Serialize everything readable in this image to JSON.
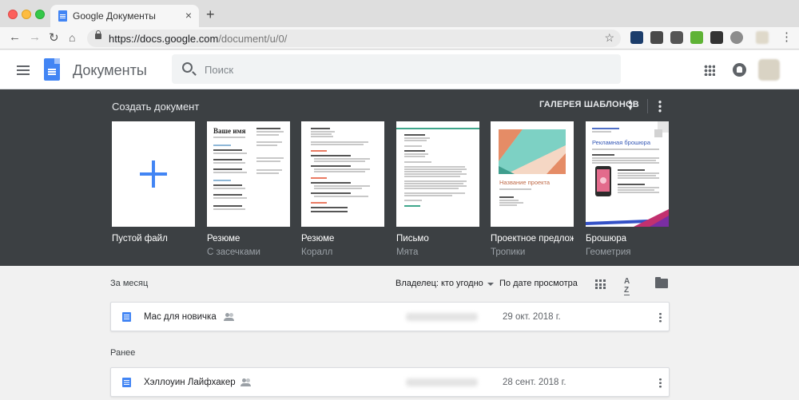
{
  "browser": {
    "tab_title": "Google Документы",
    "tab_close": "×",
    "new_tab": "+",
    "url_host": "https://docs.google.com",
    "url_path": "/document/u/0/"
  },
  "app": {
    "title": "Документы",
    "search_placeholder": "Поиск"
  },
  "templates": {
    "heading": "Создать документ",
    "gallery_label": "ГАЛЕРЕЯ ШАБЛОНОВ",
    "items": [
      {
        "name": "Пустой файл",
        "subtitle": ""
      },
      {
        "name": "Резюме",
        "subtitle": "С засечками"
      },
      {
        "name": "Резюме",
        "subtitle": "Коралл"
      },
      {
        "name": "Письмо",
        "subtitle": "Мята"
      },
      {
        "name": "Проектное предложение",
        "subtitle": "Тропики"
      },
      {
        "name": "Брошюра",
        "subtitle": "Геометрия"
      }
    ],
    "thumb_text": {
      "resume_name": "Ваше имя",
      "project_title": "Название проекта",
      "brochure_title": "Рекламная брошюра"
    }
  },
  "files": {
    "owner_filter": "Владелец: кто угодно",
    "sort_label": "По дате просмотра",
    "sections": [
      {
        "title": "За месяц",
        "docs": [
          {
            "name": "Mac для новичка",
            "date": "29 окт. 2018 г."
          }
        ]
      },
      {
        "title": "Ранее",
        "docs": [
          {
            "name": "Хэллоуин Лайфхакер",
            "date": "28 сент. 2018 г."
          }
        ]
      }
    ]
  },
  "colors": {
    "accent": "#4285f4",
    "dark_band": "#3c4043"
  },
  "icons": {
    "main_menu": "hamburger-icon",
    "apps": "apps-grid-icon",
    "notifications": "bell-icon",
    "view_toggle": "grid-view-icon",
    "sort": "sort-az-icon",
    "folder": "folder-icon"
  }
}
